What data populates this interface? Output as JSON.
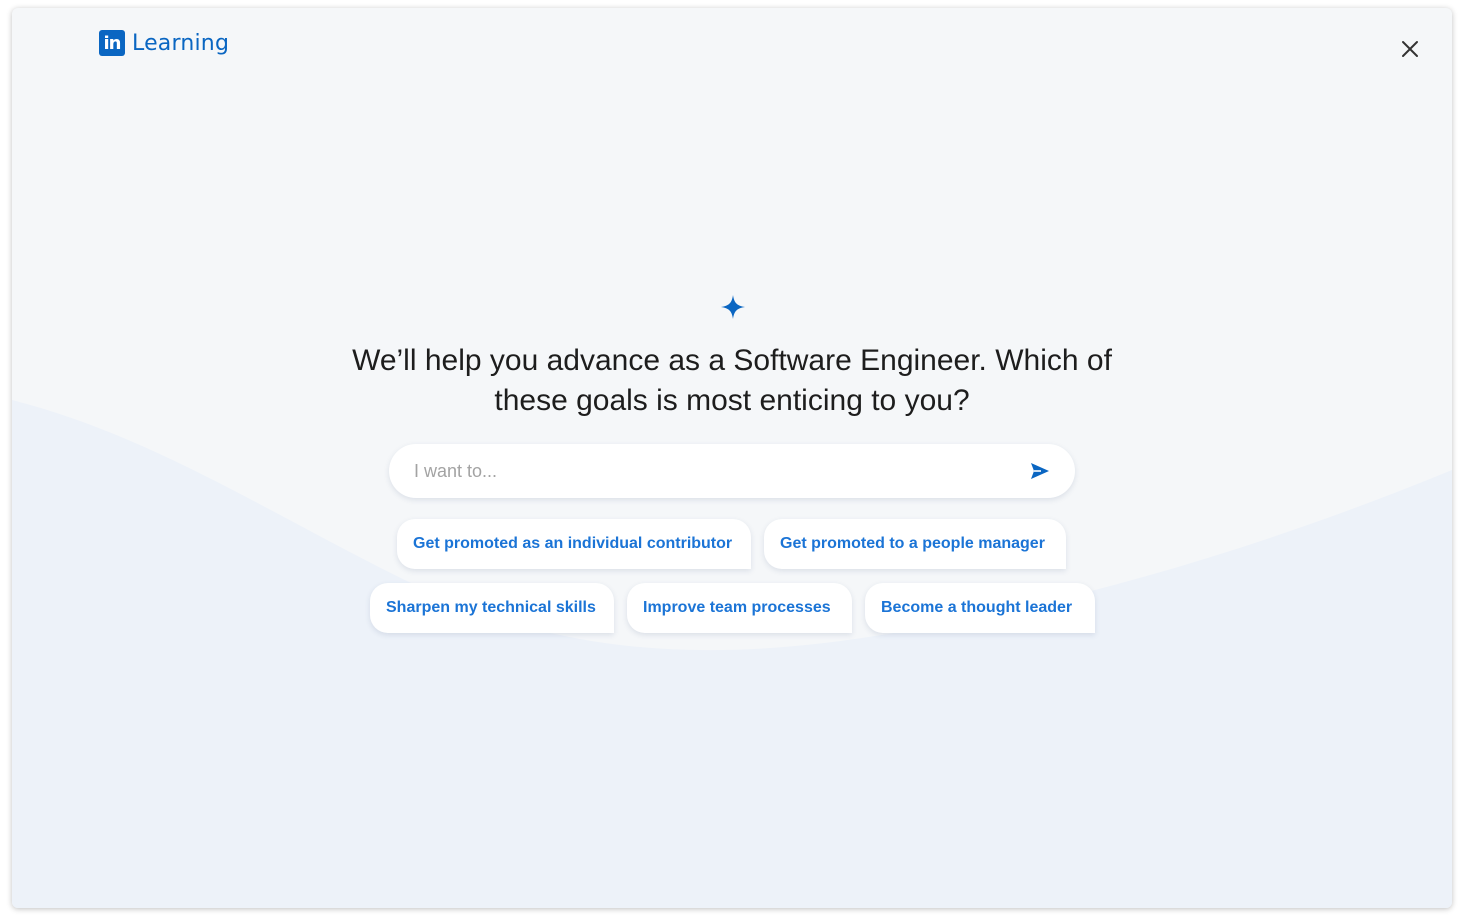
{
  "header": {
    "logo_badge": "in",
    "logo_text": "Learning",
    "close_icon": "close-icon"
  },
  "main": {
    "sparkle_icon": "sparkle-icon",
    "headline_line1": "We’ll help you advance as a Software Engineer.  Which of",
    "headline_line2": "these goals is most enticing to you?",
    "input": {
      "placeholder": "I want to...",
      "value": ""
    },
    "send_icon": "send-icon",
    "chips": [
      "Get promoted as an individual contributor",
      "Get promoted to a people manager",
      "Sharpen my technical skills",
      "Improve team processes",
      "Become a thought leader"
    ]
  },
  "colors": {
    "brand": "#0a66c2",
    "chip_text": "#1b74d6",
    "background": "#f5f7f9",
    "wave": "#edf2f9"
  }
}
